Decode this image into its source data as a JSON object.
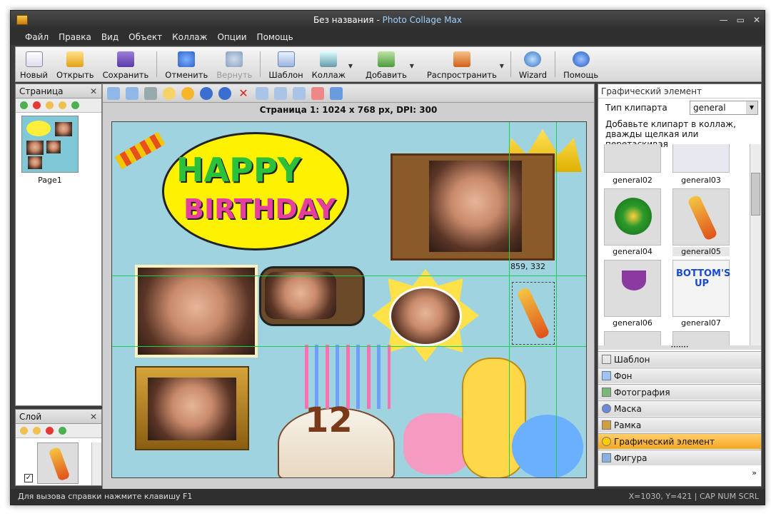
{
  "window": {
    "title_doc": "Без названия",
    "title_sep": " - ",
    "title_app": "Photo Collage Max"
  },
  "menu": [
    "Файл",
    "Правка",
    "Вид",
    "Объект",
    "Коллаж",
    "Опции",
    "Помощь"
  ],
  "toolbar": {
    "new": "Новый",
    "open": "Открыть",
    "save": "Сохранить",
    "undo": "Отменить",
    "redo": "Вернуть",
    "template": "Шаблон",
    "collage": "Коллаж",
    "add": "Добавить",
    "share": "Распространить",
    "wizard": "Wizard",
    "help": "Помощь"
  },
  "pages_panel": {
    "title": "Страница",
    "page_label": "Page1"
  },
  "layers_panel": {
    "title": "Слой"
  },
  "canvas": {
    "page_info": "Страница 1: 1024 x 768 px, DPI: 300",
    "coord_readout": "859, 332"
  },
  "right_panel": {
    "title": "Графический элемент",
    "clip_type_label": "Тип клипарта",
    "clip_type_value": "general",
    "hint": "Добавьте клипарт в коллаж, дважды щелкая или перетаскивая",
    "clips": [
      "general02",
      "general03",
      "general04",
      "general05",
      "general06",
      "general07"
    ],
    "bottoms_text": "BOTTOM'S UP",
    "sections": [
      "Шаблон",
      "Фон",
      "Фотография",
      "Маска",
      "Рамка",
      "Графический элемент",
      "Фигура"
    ]
  },
  "status": {
    "help": "Для вызова справки нажмите клавишу F1",
    "coords": "X=1030, Y=421",
    "indicators": "CAP NUM SCRL"
  },
  "artwork": {
    "happy": "HAPPY",
    "birthday": "BIRTHDAY",
    "cake_number": "12"
  }
}
